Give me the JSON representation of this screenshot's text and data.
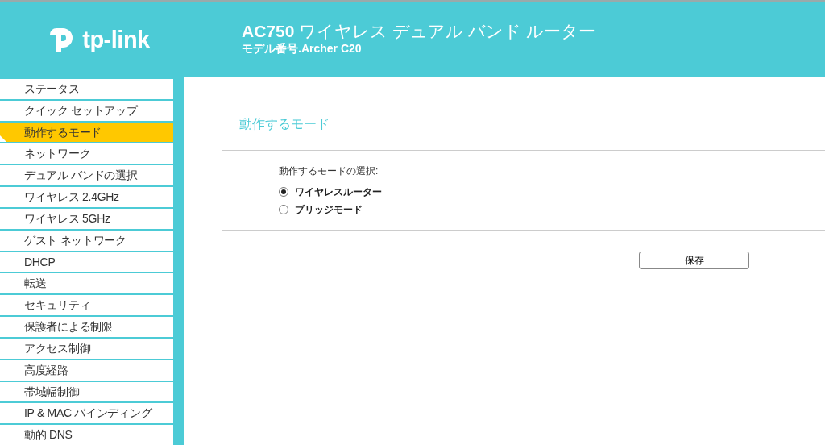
{
  "header": {
    "logo_text": "tp-link",
    "title": "**AC750** ワイヤレス デュアル バンド ルーター",
    "model": "モデル番号.Archer C20"
  },
  "sidebar": {
    "items": [
      {
        "label": "ステータス",
        "selected": false
      },
      {
        "label": "クイック セットアップ",
        "selected": false
      },
      {
        "label": "動作するモード",
        "selected": true
      },
      {
        "label": "ネットワーク",
        "selected": false
      },
      {
        "label": "デュアル バンドの選択",
        "selected": false
      },
      {
        "label": "ワイヤレス 2.4GHz",
        "selected": false
      },
      {
        "label": "ワイヤレス 5GHz",
        "selected": false
      },
      {
        "label": "ゲスト ネットワーク",
        "selected": false
      },
      {
        "label": "DHCP",
        "selected": false
      },
      {
        "label": "転送",
        "selected": false
      },
      {
        "label": "セキュリティ",
        "selected": false
      },
      {
        "label": "保護者による制限",
        "selected": false
      },
      {
        "label": "アクセス制御",
        "selected": false
      },
      {
        "label": "高度経路",
        "selected": false
      },
      {
        "label": "帯域幅制御",
        "selected": false
      },
      {
        "label": "IP & MAC バインディング",
        "selected": false
      },
      {
        "label": "動的 DNS",
        "selected": false
      }
    ]
  },
  "main": {
    "heading": "動作するモード",
    "field_label": "動作するモードの選択:",
    "options": [
      {
        "label": "ワイヤレスルーター",
        "selected": true
      },
      {
        "label": "ブリッジモード",
        "selected": false
      }
    ],
    "save_button": "保存"
  }
}
